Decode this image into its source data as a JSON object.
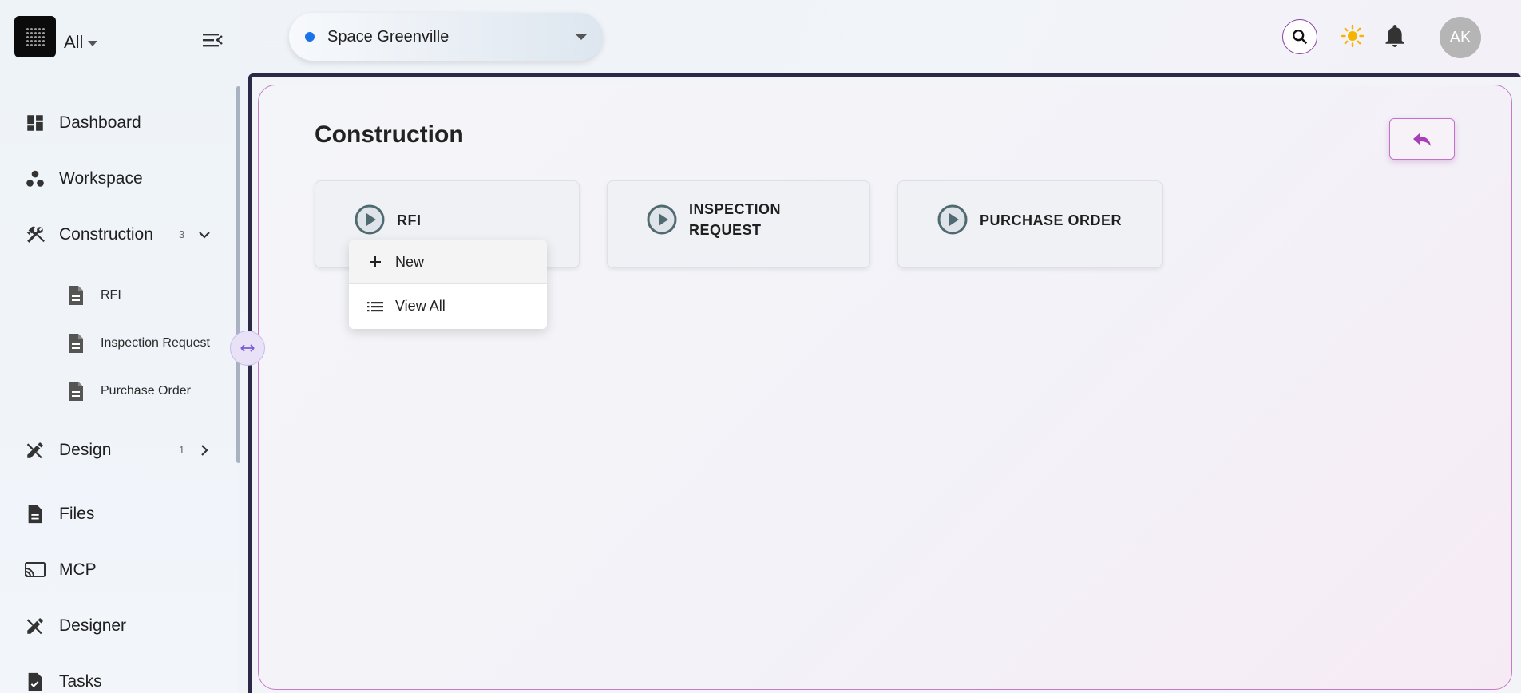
{
  "sidebar": {
    "scope_label": "All",
    "items": [
      {
        "label": "Dashboard",
        "icon": "dashboard-icon"
      },
      {
        "label": "Workspace",
        "icon": "workspace-icon"
      },
      {
        "label": "Construction",
        "icon": "tools-icon",
        "count": "3",
        "expanded": true
      },
      {
        "label": "Design",
        "icon": "design-icon",
        "count": "1",
        "expanded": false
      },
      {
        "label": "Files",
        "icon": "file-icon"
      },
      {
        "label": "MCP",
        "icon": "cast-icon"
      },
      {
        "label": "Designer",
        "icon": "design-icon"
      },
      {
        "label": "Tasks",
        "icon": "task-icon"
      }
    ],
    "sub_items": [
      {
        "label": "RFI",
        "icon": "document-icon"
      },
      {
        "label": "Inspection Request",
        "icon": "document-icon"
      },
      {
        "label": "Purchase Order",
        "icon": "document-icon"
      }
    ]
  },
  "header": {
    "space_name": "Space Greenville",
    "space_dot_color": "#1a73e8",
    "avatar_initials": "AK"
  },
  "main": {
    "title": "Construction",
    "cards": [
      {
        "label": "RFI"
      },
      {
        "label": "INSPECTION REQUEST",
        "line1": "INSPECTION",
        "line2": "REQUEST"
      },
      {
        "label": "PURCHASE ORDER"
      }
    ],
    "menu": [
      {
        "label": "New",
        "icon": "plus-icon"
      },
      {
        "label": "View All",
        "icon": "list-icon"
      }
    ]
  },
  "colors": {
    "accent": "#a63fb8",
    "card_icon": "#4f6b70",
    "sun": "#f4b400"
  }
}
